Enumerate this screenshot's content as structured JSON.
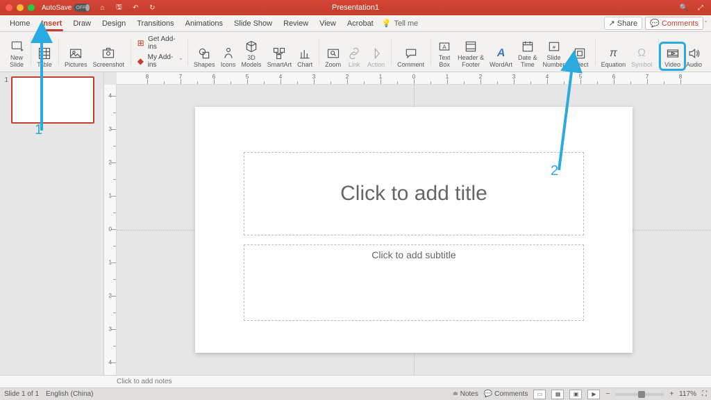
{
  "titlebar": {
    "autosave_label": "AutoSave",
    "autosave_state": "OFF",
    "doc_title": "Presentation1"
  },
  "tabs": {
    "items": [
      "Home",
      "Insert",
      "Draw",
      "Design",
      "Transitions",
      "Animations",
      "Slide Show",
      "Review",
      "View",
      "Acrobat"
    ],
    "active_index": 1,
    "tell_me": "Tell me",
    "share": "Share",
    "comments": "Comments"
  },
  "ribbon": {
    "new_slide": "New\nSlide",
    "table": "Table",
    "pictures": "Pictures",
    "screenshot": "Screenshot",
    "get_addins": "Get Add-ins",
    "my_addins": "My Add-ins",
    "shapes": "Shapes",
    "icons": "Icons",
    "models": "3D\nModels",
    "smartart": "SmartArt",
    "chart": "Chart",
    "zoom": "Zoom",
    "link": "Link",
    "action": "Action",
    "comment": "Comment",
    "textbox": "Text\nBox",
    "headerfooter": "Header &\nFooter",
    "wordart": "WordArt",
    "datetime": "Date &\nTime",
    "slidenumber": "Slide\nNumber",
    "object": "Object",
    "equation": "Equation",
    "symbol": "Symbol",
    "video": "Video",
    "audio": "Audio"
  },
  "slide": {
    "thumb_number": "1",
    "title_placeholder": "Click to add title",
    "subtitle_placeholder": "Click to add subtitle"
  },
  "notes": {
    "placeholder": "Click to add notes"
  },
  "status": {
    "slide_info": "Slide 1 of 1",
    "language": "English (China)",
    "notes_btn": "Notes",
    "comments_btn": "Comments",
    "zoom": "117%"
  },
  "annotations": {
    "one": "1",
    "two": "2"
  },
  "colors": {
    "brand": "#c43e2c",
    "highlight": "#29abe2"
  }
}
